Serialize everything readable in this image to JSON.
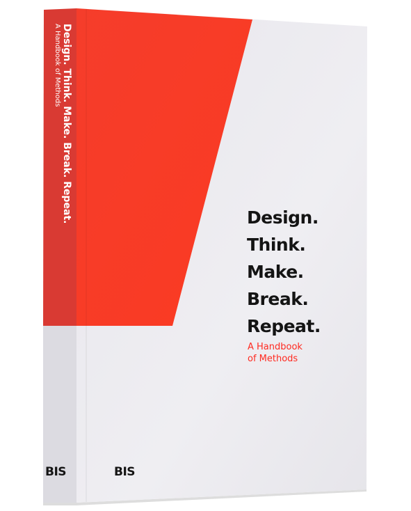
{
  "book": {
    "spine_title": "Design. Think. Make. Break. Repeat.",
    "spine_subtitle": "A Handbook of Methods",
    "title_lines": [
      "Design.",
      "Think.",
      "Make.",
      "Break.",
      "Repeat."
    ],
    "subtitle_lines": [
      "A Handbook",
      "of Methods"
    ],
    "publisher_logo": "BIS",
    "colors": {
      "accent_red": "#fa3a26",
      "cover_white": "#ebeaef",
      "text_dark": "#141414"
    }
  }
}
